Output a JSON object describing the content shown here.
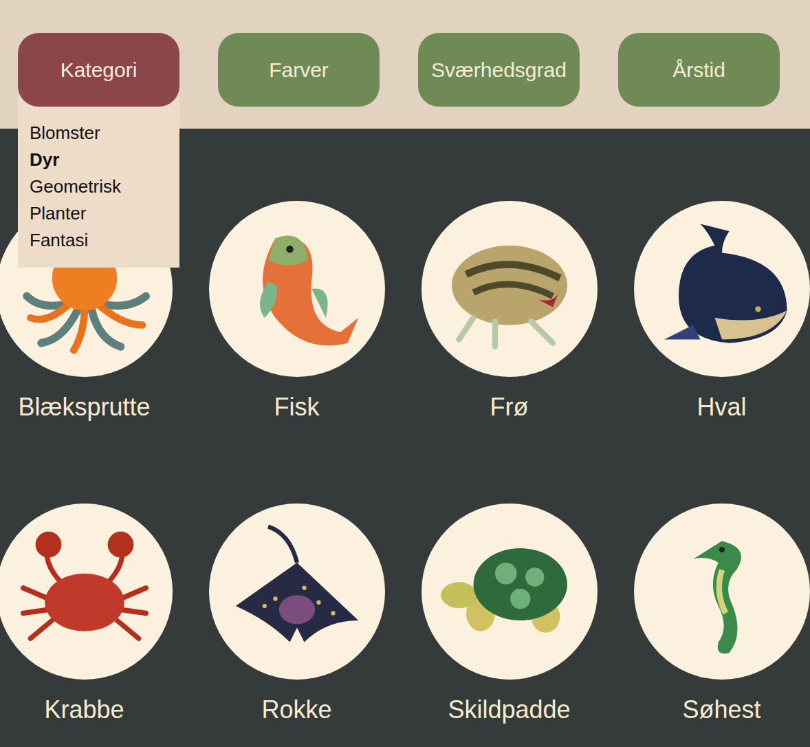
{
  "filters": [
    {
      "label": "Kategori",
      "selected": true,
      "open": true,
      "options": [
        {
          "label": "Blomster",
          "selected": false
        },
        {
          "label": "Dyr",
          "selected": true
        },
        {
          "label": "Geometrisk",
          "selected": false
        },
        {
          "label": "Planter",
          "selected": false
        },
        {
          "label": "Fantasi",
          "selected": false
        }
      ]
    },
    {
      "label": "Farver",
      "selected": false,
      "open": false
    },
    {
      "label": "Sværhedsgrad",
      "selected": false,
      "open": false
    },
    {
      "label": "Årstid",
      "selected": false,
      "open": false
    }
  ],
  "patterns": [
    {
      "name": "Blæksprutte"
    },
    {
      "name": "Fisk"
    },
    {
      "name": "Frø"
    },
    {
      "name": "Hval"
    },
    {
      "name": "Krabbe"
    },
    {
      "name": "Rokke"
    },
    {
      "name": "Skildpadde"
    },
    {
      "name": "Søhest"
    }
  ]
}
